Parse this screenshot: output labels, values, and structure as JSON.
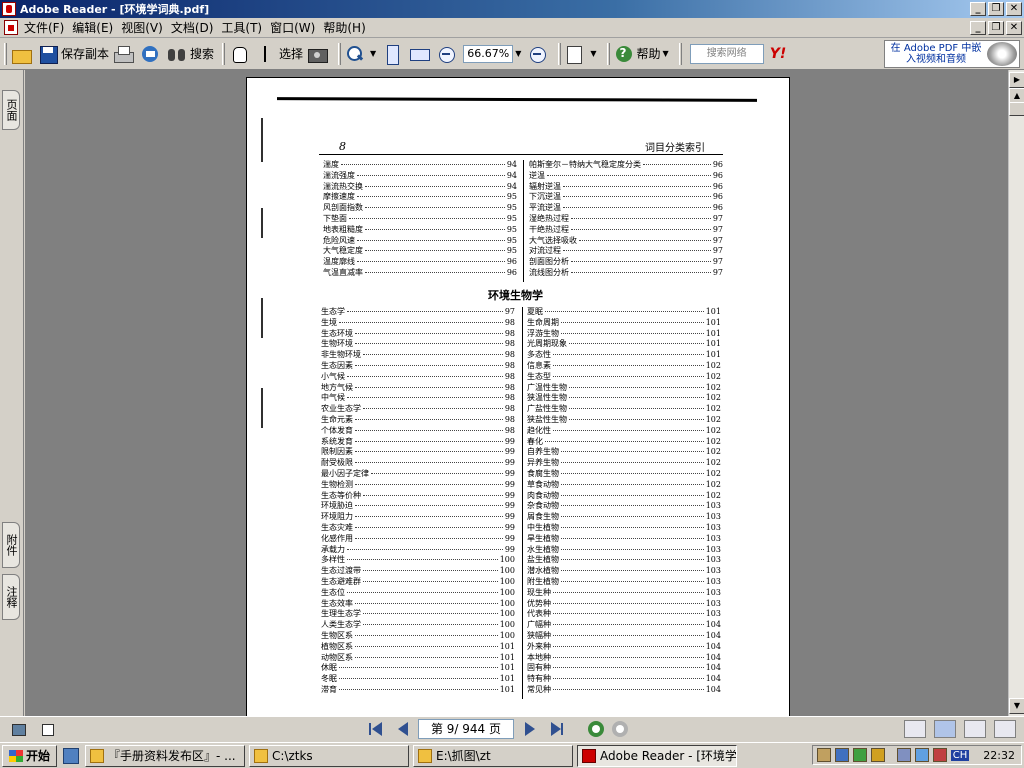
{
  "window": {
    "title": "Adobe Reader - [环境学词典.pdf]",
    "minimize": "_",
    "restore": "❐",
    "close": "✕"
  },
  "menu": [
    "文件(F)",
    "编辑(E)",
    "视图(V)",
    "文档(D)",
    "工具(T)",
    "窗口(W)",
    "帮助(H)"
  ],
  "toolbar": {
    "save_copy": "保存副本",
    "search": "搜索",
    "select": "选择",
    "zoom_value": "66.67%",
    "help": "帮助",
    "search_web_placeholder": "搜索网络",
    "yahoo": "Y!",
    "ad_line1": "在 Adobe PDF 中嵌",
    "ad_line2": "入视频和音频"
  },
  "side_tabs": {
    "pages": "页面",
    "attachments": "附件",
    "comments": "注释"
  },
  "document": {
    "page_number": "8",
    "running_head": "词目分类索引",
    "section_title": "环境生物学",
    "top_left": [
      [
        "湍度",
        "94"
      ],
      [
        "湍流强度",
        "94"
      ],
      [
        "湍流热交换",
        "94"
      ],
      [
        "摩擦速度",
        "95"
      ],
      [
        "风剖面指数",
        "95"
      ],
      [
        "下垫面",
        "95"
      ],
      [
        "地表粗糙度",
        "95"
      ],
      [
        "危险风速",
        "95"
      ],
      [
        "大气稳定度",
        "95"
      ],
      [
        "温度廓线",
        "96"
      ],
      [
        "气温直减率",
        "96"
      ]
    ],
    "top_right": [
      [
        "帕斯奎尔－特纳大气稳定度分类",
        "96"
      ],
      [
        "逆温",
        "96"
      ],
      [
        "辐射逆温",
        "96"
      ],
      [
        "下沉逆温",
        "96"
      ],
      [
        "平流逆温",
        "96"
      ],
      [
        "湿绝热过程",
        "97"
      ],
      [
        "干绝热过程",
        "97"
      ],
      [
        "大气选择吸收",
        "97"
      ],
      [
        "对流过程",
        "97"
      ],
      [
        "剖面图分析",
        "97"
      ],
      [
        "流线图分析",
        "97"
      ]
    ],
    "bottom_left": [
      [
        "生态学",
        "97"
      ],
      [
        "生境",
        "98"
      ],
      [
        "生态环境",
        "98"
      ],
      [
        "生物环境",
        "98"
      ],
      [
        "非生物环境",
        "98"
      ],
      [
        "生态因素",
        "98"
      ],
      [
        "小气候",
        "98"
      ],
      [
        "地方气候",
        "98"
      ],
      [
        "中气候",
        "98"
      ],
      [
        "农业生态学",
        "98"
      ],
      [
        "生命元素",
        "98"
      ],
      [
        "个体发育",
        "98"
      ],
      [
        "系统发育",
        "99"
      ],
      [
        "限制因素",
        "99"
      ],
      [
        "耐受极限",
        "99"
      ],
      [
        "最小因子定律",
        "99"
      ],
      [
        "生物检测",
        "99"
      ],
      [
        "生态等价种",
        "99"
      ],
      [
        "环境胁迫",
        "99"
      ],
      [
        "环境阻力",
        "99"
      ],
      [
        "生态灾难",
        "99"
      ],
      [
        "化感作用",
        "99"
      ],
      [
        "承载力",
        "99"
      ],
      [
        "多样性",
        "100"
      ],
      [
        "生态过渡带",
        "100"
      ],
      [
        "生态避难群",
        "100"
      ],
      [
        "生态位",
        "100"
      ],
      [
        "生态效率",
        "100"
      ],
      [
        "生理生态学",
        "100"
      ],
      [
        "人类生态学",
        "100"
      ],
      [
        "生物区系",
        "100"
      ],
      [
        "植物区系",
        "101"
      ],
      [
        "动物区系",
        "101"
      ],
      [
        "休眠",
        "101"
      ],
      [
        "冬眠",
        "101"
      ],
      [
        "滞育",
        "101"
      ]
    ],
    "bottom_right": [
      [
        "夏眠",
        "101"
      ],
      [
        "生命周期",
        "101"
      ],
      [
        "浮游生物",
        "101"
      ],
      [
        "光周期现象",
        "101"
      ],
      [
        "多态性",
        "101"
      ],
      [
        "信息素",
        "102"
      ],
      [
        "生态型",
        "102"
      ],
      [
        "广温性生物",
        "102"
      ],
      [
        "狭温性生物",
        "102"
      ],
      [
        "广盐性生物",
        "102"
      ],
      [
        "狭盐性生物",
        "102"
      ],
      [
        "趋化性",
        "102"
      ],
      [
        "春化",
        "102"
      ],
      [
        "自养生物",
        "102"
      ],
      [
        "异养生物",
        "102"
      ],
      [
        "食腐生物",
        "102"
      ],
      [
        "草食动物",
        "102"
      ],
      [
        "肉食动物",
        "102"
      ],
      [
        "杂食动物",
        "103"
      ],
      [
        "屑食生物",
        "103"
      ],
      [
        "中生植物",
        "103"
      ],
      [
        "旱生植物",
        "103"
      ],
      [
        "水生植物",
        "103"
      ],
      [
        "盐生植物",
        "103"
      ],
      [
        "潜水植物",
        "103"
      ],
      [
        "附生植物",
        "103"
      ],
      [
        "现生种",
        "103"
      ],
      [
        "优势种",
        "103"
      ],
      [
        "代表种",
        "103"
      ],
      [
        "广幅种",
        "104"
      ],
      [
        "狭幅种",
        "104"
      ],
      [
        "外来种",
        "104"
      ],
      [
        "本地种",
        "104"
      ],
      [
        "固有种",
        "104"
      ],
      [
        "特有种",
        "104"
      ],
      [
        "常见种",
        "104"
      ]
    ]
  },
  "navigation": {
    "page_display": "第 9/ 944 页"
  },
  "taskbar": {
    "start": "开始",
    "tasks": [
      "『手册资料发布区』- ...",
      "C:\\ztks",
      "E:\\抓图\\zt",
      "Adobe Reader - [环境学..."
    ],
    "lang": "CH",
    "clock": "22:32"
  }
}
